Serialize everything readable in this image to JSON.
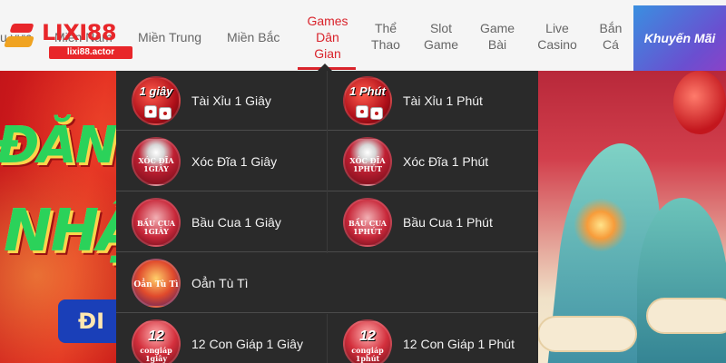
{
  "brand": {
    "name": "LIXI88",
    "domain": "lixi88.actor"
  },
  "nav": {
    "partial_first": "u vực",
    "partial_second": "Miền Nam",
    "items": [
      {
        "label": "Miền Trung"
      },
      {
        "label": "Miền Bắc"
      },
      {
        "label": "Games Dân Gian",
        "lines": [
          "Games",
          "Dân",
          "Gian"
        ],
        "active": true
      },
      {
        "label": "Thể Thao",
        "lines": [
          "Thể",
          "Thao"
        ]
      },
      {
        "label": "Slot Game",
        "lines": [
          "Slot",
          "Game"
        ]
      },
      {
        "label": "Game Bài",
        "lines": [
          "Game",
          "Bài"
        ]
      },
      {
        "label": "Live Casino",
        "lines": [
          "Live",
          "Casino"
        ]
      },
      {
        "label": "Bắn Cá",
        "lines": [
          "Bắn",
          "Cá"
        ]
      }
    ],
    "promo": "Khuyến Mãi"
  },
  "banner": {
    "left_word_1": "ĐĂN",
    "left_word_2": "NHẬ",
    "left_button": "ĐI"
  },
  "dropdown": {
    "rows": [
      [
        {
          "label": "Tài Xỉu 1 Giây",
          "icon": "tai-xiu-1-giay-icon",
          "glyph": "1 giây"
        },
        {
          "label": "Tài Xỉu 1 Phút",
          "icon": "tai-xiu-1-phut-icon",
          "glyph": "1 Phút"
        }
      ],
      [
        {
          "label": "Xóc Đĩa 1 Giây",
          "icon": "xoc-dia-1-giay-icon",
          "glyph": "XÓC ĐĨA 1GIÂY"
        },
        {
          "label": "Xóc Đĩa 1 Phút",
          "icon": "xoc-dia-1-phut-icon",
          "glyph": "XÓC ĐĨA 1PHÚT"
        }
      ],
      [
        {
          "label": "Bầu Cua 1 Giây",
          "icon": "bau-cua-1-giay-icon",
          "glyph": "BẦU CUA 1GIÂY"
        },
        {
          "label": "Bầu Cua 1 Phút",
          "icon": "bau-cua-1-phut-icon",
          "glyph": "BẦU CUA 1PHÚT"
        }
      ],
      [
        {
          "label": "Oẳn Tù Tì",
          "icon": "oan-tu-ti-icon",
          "glyph": "Oẳn Tù Tì"
        }
      ],
      [
        {
          "label": "12 Con Giáp 1 Giây",
          "icon": "12-con-giap-1-giay-icon",
          "glyph": "12",
          "sub": "congiáp 1giây"
        },
        {
          "label": "12 Con Giáp 1 Phút",
          "icon": "12-con-giap-1-phut-icon",
          "glyph": "12",
          "sub": "congiáp 1phút"
        }
      ]
    ]
  },
  "colors": {
    "accent": "#d9232b",
    "dropdown_bg": "#2a2a2a",
    "header_bg": "#f5f5f5"
  }
}
